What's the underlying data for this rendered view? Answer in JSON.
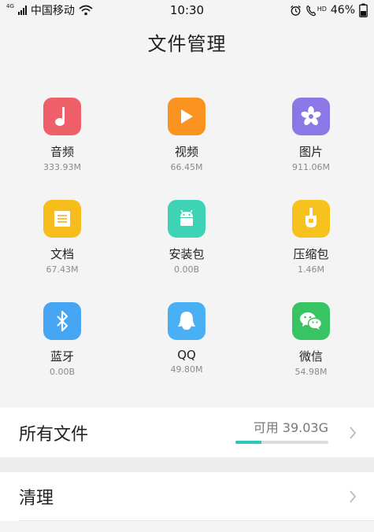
{
  "status_bar": {
    "network": "4G",
    "carrier": "中国移动",
    "time": "10:30",
    "volte": "HD",
    "battery": "46%"
  },
  "header": {
    "title": "文件管理"
  },
  "categories": [
    {
      "label": "音频",
      "size": "333.93M",
      "icon": "music-note-icon",
      "color": "#ee5f6a"
    },
    {
      "label": "视频",
      "size": "66.45M",
      "icon": "play-icon",
      "color": "#fb9320"
    },
    {
      "label": "图片",
      "size": "911.06M",
      "icon": "flower-icon",
      "color": "#8b77e6"
    },
    {
      "label": "文档",
      "size": "67.43M",
      "icon": "document-icon",
      "color": "#f7bd1c"
    },
    {
      "label": "安装包",
      "size": "0.00B",
      "icon": "android-icon",
      "color": "#3ed3b5"
    },
    {
      "label": "压缩包",
      "size": "1.46M",
      "icon": "zip-icon",
      "color": "#f8c21e"
    },
    {
      "label": "蓝牙",
      "size": "0.00B",
      "icon": "bluetooth-icon",
      "color": "#46a6f3"
    },
    {
      "label": "QQ",
      "size": "49.80M",
      "icon": "qq-penguin-icon",
      "color": "#4ab0f5"
    },
    {
      "label": "微信",
      "size": "54.98M",
      "icon": "wechat-icon",
      "color": "#38c462"
    }
  ],
  "all_files": {
    "label": "所有文件",
    "available": "可用 39.03G",
    "used_fraction": 0.28,
    "bar_color": "#2fc7b8"
  },
  "cleanup": {
    "label": "清理"
  }
}
